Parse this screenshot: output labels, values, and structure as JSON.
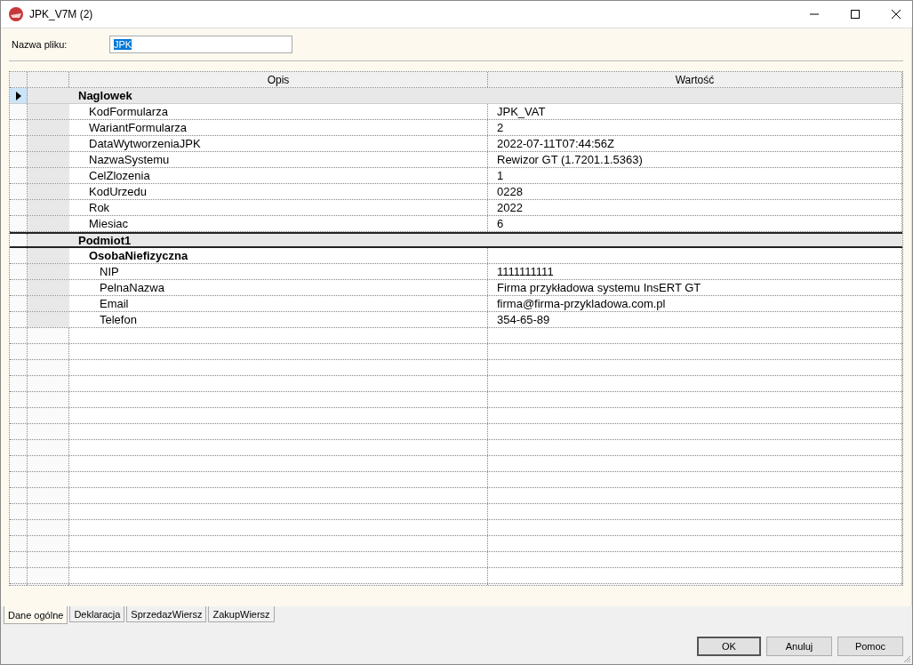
{
  "window": {
    "title": "JPK_V7M (2)"
  },
  "file_name": {
    "label": "Nazwa pliku:",
    "value": "JPK",
    "text_selected": true
  },
  "grid": {
    "columns": [
      "Opis",
      "Wartość"
    ],
    "rows": [
      {
        "name": "Naglowek",
        "selected": true,
        "children": [
          {
            "name": "KodFormularza",
            "value": "JPK_VAT",
            "selected": false
          },
          {
            "name": "WariantFormularza",
            "value": "2",
            "selected": false
          },
          {
            "name": "DataWytworzeniaJPK",
            "value": "2022-07-11T07:44:56Z",
            "selected": false
          },
          {
            "name": "NazwaSystemu",
            "value": "Rewizor GT (1.7201.1.5363)",
            "selected": false
          },
          {
            "name": "CelZlozenia",
            "value": "1",
            "selected": false
          },
          {
            "name": "KodUrzedu",
            "value": "0228",
            "selected": false
          },
          {
            "name": "Rok",
            "value": "2022",
            "selected": false
          },
          {
            "name": "Miesiac",
            "value": "6",
            "selected": false
          }
        ]
      },
      {
        "name": "Podmiot1",
        "selected": false,
        "children": [
          {
            "name": "OsobaNiefizyczna",
            "selected": false,
            "children": [
              {
                "name": "NIP",
                "value": "1111111111",
                "selected": false
              },
              {
                "name": "PelnaNazwa",
                "value": "Firma przykładowa systemu InsERT GT",
                "selected": false
              },
              {
                "name": "Email",
                "value": "firma@firma-przykladowa.com.pl",
                "selected": false
              },
              {
                "name": "Telefon",
                "value": "354-65-89",
                "selected": false
              }
            ]
          }
        ]
      }
    ]
  },
  "tabs": [
    {
      "label": "Dane ogólne",
      "selected": true
    },
    {
      "label": "Deklaracja",
      "selected": false
    },
    {
      "label": "SprzedazWiersz",
      "selected": false
    },
    {
      "label": "ZakupWiersz",
      "selected": false
    }
  ],
  "buttons": [
    {
      "label": "OK",
      "default": true
    },
    {
      "label": "Anuluj",
      "default": false
    },
    {
      "label": "Pomoc",
      "default": false
    }
  ]
}
